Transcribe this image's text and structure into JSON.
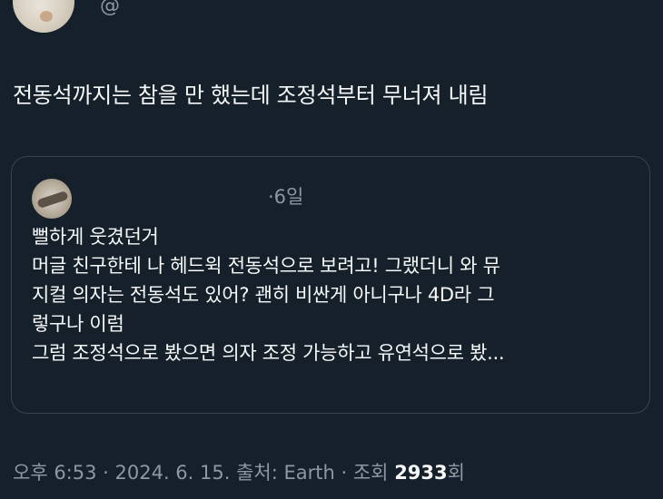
{
  "header": {
    "handle": "@"
  },
  "tweet": {
    "text": "전동석까지는 참을 만 했는데 조정석부터 무너져 내림"
  },
  "quote": {
    "meta": "·6일",
    "lines": [
      "뻘하게 웃겼던거",
      "머글 친구한테 나 헤드윅 전동석으로 보려고! 그랬더니 와 뮤",
      "지컬 의자는 전동석도 있어? 괜히 비싼게 아니구나 4D라 그",
      "렇구나 이럼",
      "그럼 조정석으로 봤으면 의자 조정 가능하고 유연석으로 봤..."
    ]
  },
  "footer": {
    "time": "오후 6:53",
    "date": "2024. 6. 15.",
    "source": "출처: Earth",
    "views_label": "조회",
    "views_count": "2933",
    "views_suffix": "회",
    "separator": " · "
  },
  "colors": {
    "background": "#15202b",
    "text": "#f7f9f9",
    "muted": "#8b98a5",
    "border": "#38444d"
  }
}
